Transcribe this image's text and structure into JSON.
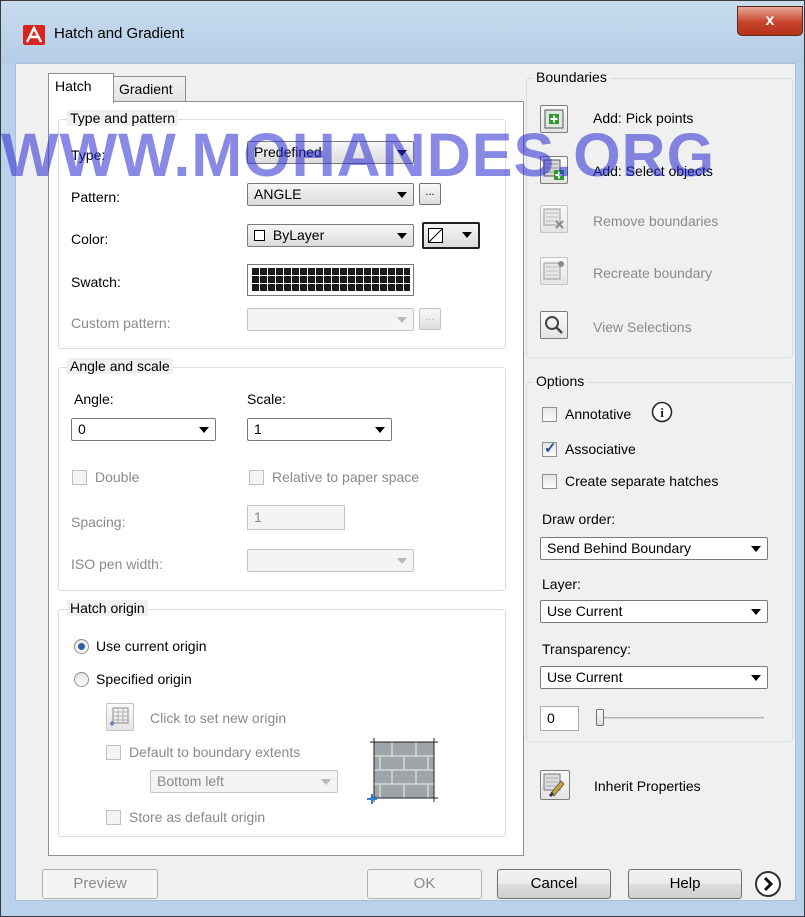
{
  "window": {
    "title": "Hatch and Gradient",
    "close_label": "x"
  },
  "tabs": [
    {
      "label": "Hatch",
      "active": true
    },
    {
      "label": "Gradient",
      "active": false
    }
  ],
  "type_pattern": {
    "group_title": "Type and pattern",
    "type_label": "Type:",
    "type_value": "Predefined",
    "pattern_label": "Pattern:",
    "pattern_value": "ANGLE",
    "pattern_browse": "...",
    "color_label": "Color:",
    "color_value": "ByLayer",
    "swatch_label": "Swatch:",
    "custom_label": "Custom pattern:",
    "custom_browse": "..."
  },
  "angle_scale": {
    "group_title": "Angle and scale",
    "angle_label": "Angle:",
    "angle_value": "0",
    "scale_label": "Scale:",
    "scale_value": "1",
    "double_label": "Double",
    "relative_label": "Relative to paper space",
    "spacing_label": "Spacing:",
    "spacing_value": "1",
    "iso_label": "ISO pen width:"
  },
  "hatch_origin": {
    "group_title": "Hatch origin",
    "use_current": "Use current origin",
    "specified": "Specified origin",
    "click_set": "Click to set new origin",
    "default_extents": "Default to boundary extents",
    "extents_value": "Bottom left",
    "store_default": "Store as default origin"
  },
  "boundaries": {
    "group_title": "Boundaries",
    "add_pick": "Add: Pick points",
    "add_select": "Add: Select objects",
    "remove": "Remove boundaries",
    "recreate": "Recreate boundary",
    "view": "View Selections"
  },
  "options": {
    "group_title": "Options",
    "annotative": "Annotative",
    "associative": "Associative",
    "associative_checked": true,
    "separate": "Create separate hatches",
    "draw_order_label": "Draw order:",
    "draw_order_value": "Send Behind Boundary",
    "layer_label": "Layer:",
    "layer_value": "Use Current",
    "transparency_label": "Transparency:",
    "transparency_value": "Use Current",
    "transparency_amount": "0"
  },
  "inherit": "Inherit Properties",
  "buttons": {
    "preview": "Preview",
    "ok": "OK",
    "cancel": "Cancel",
    "help": "Help"
  },
  "watermark": "WWW.MOHANDES.ORG",
  "colors": {
    "title_bg": "#b9d1ea",
    "close_red": "#c7432b",
    "watermark": "#2828d2"
  }
}
